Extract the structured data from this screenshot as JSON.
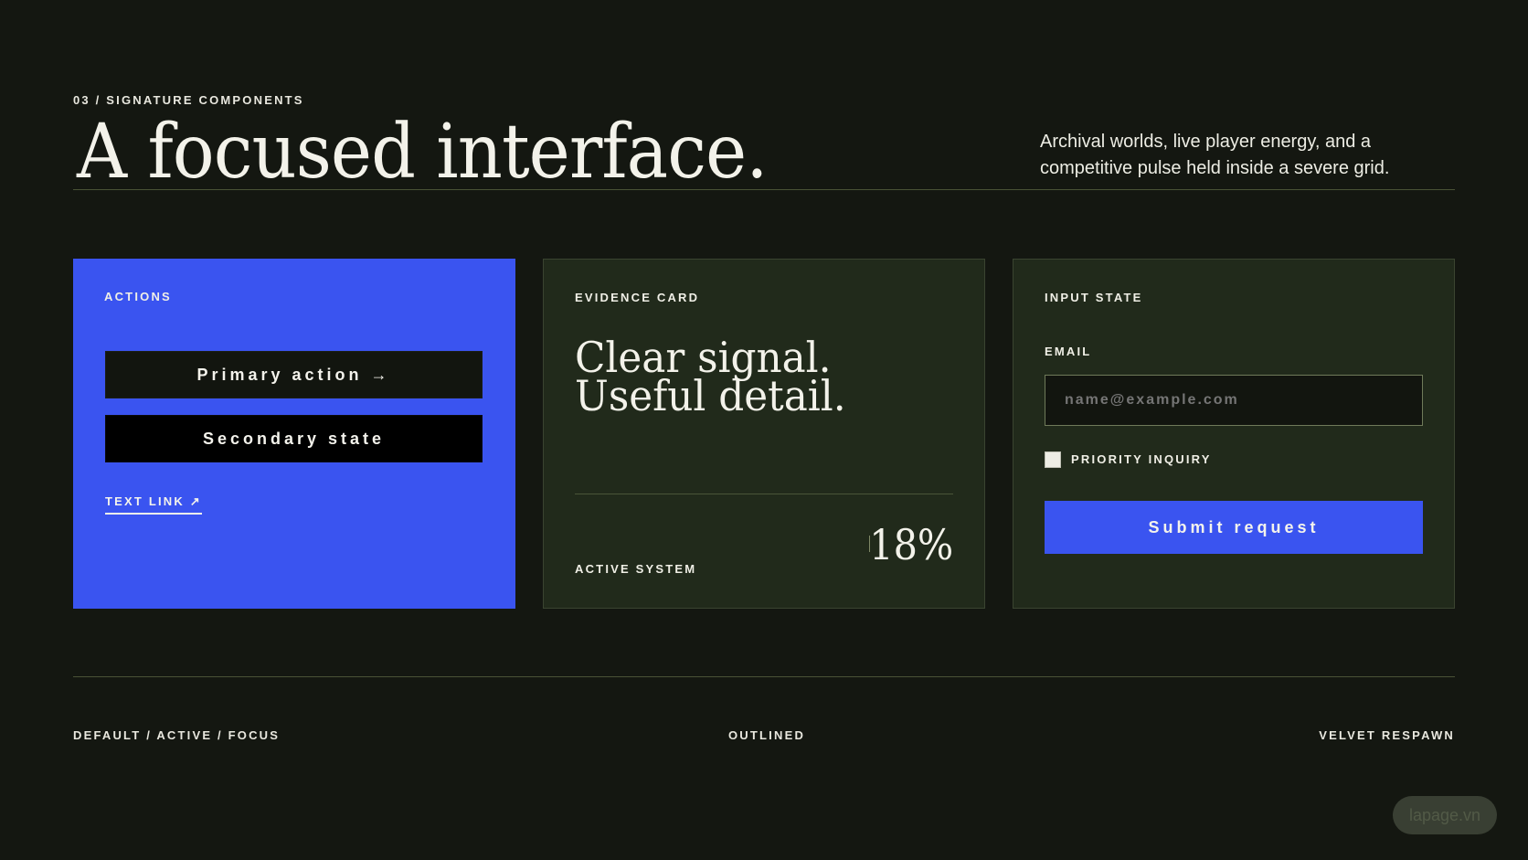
{
  "header": {
    "eyebrow": "03 / SIGNATURE COMPONENTS",
    "headline": "A focused interface.",
    "intro": "Archival worlds, live player energy, and a competitive pulse held inside a severe grid."
  },
  "actions_card": {
    "label": "ACTIONS",
    "primary_button": "Primary action →",
    "secondary_button": "Secondary state",
    "text_link": "TEXT LINK ↗"
  },
  "evidence_card": {
    "label": "EVIDENCE CARD",
    "headline_line1": "Clear signal.",
    "headline_line2": "Useful detail.",
    "status": "ACTIVE SYSTEM",
    "metric": "18%"
  },
  "input_card": {
    "label": "INPUT STATE",
    "email_label": "EMAIL",
    "email_placeholder": "name@example.com",
    "checkbox_label": "PRIORITY INQUIRY",
    "checkbox_checked": false,
    "submit_button": "Submit request"
  },
  "footer": {
    "left": "DEFAULT / ACTIVE / FOCUS",
    "center": "OUTLINED",
    "right": "VELVET RESPAWN"
  },
  "watermark": "lapage.vn",
  "colors": {
    "background": "#141711",
    "accent_blue": "#3A54F0",
    "card_dark_green": "#212A1B",
    "text_cream": "#F1F0E8"
  }
}
